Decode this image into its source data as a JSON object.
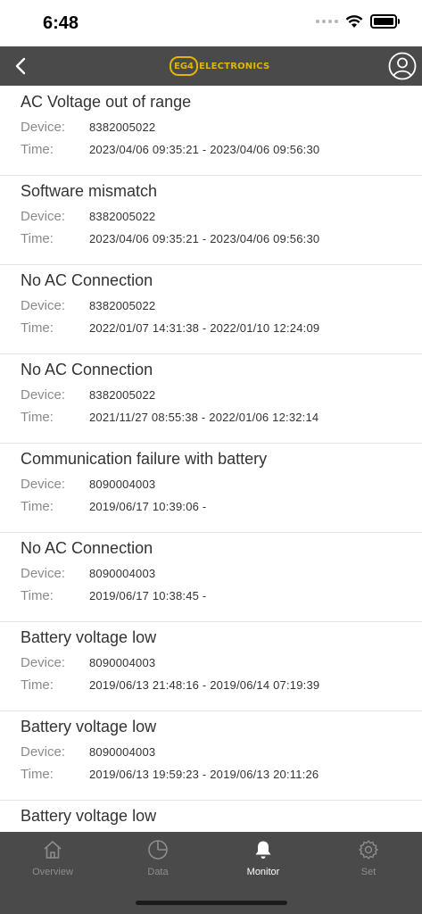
{
  "status_bar": {
    "time": "6:48"
  },
  "header": {
    "logo_badge": "EG4",
    "logo_text": "ELECTRONICS"
  },
  "labels": {
    "device": "Device:",
    "time": "Time:"
  },
  "alarms": [
    {
      "title": "AC Voltage out of range",
      "device": "8382005022",
      "time": "2023/04/06 09:35:21 - 2023/04/06 09:56:30"
    },
    {
      "title": "Software mismatch",
      "device": "8382005022",
      "time": "2023/04/06 09:35:21 - 2023/04/06 09:56:30"
    },
    {
      "title": "No AC Connection",
      "device": "8382005022",
      "time": "2022/01/07 14:31:38 - 2022/01/10 12:24:09"
    },
    {
      "title": "No AC Connection",
      "device": "8382005022",
      "time": "2021/11/27 08:55:38 - 2022/01/06 12:32:14"
    },
    {
      "title": "Communication failure with battery",
      "device": "8090004003",
      "time": "2019/06/17 10:39:06 -"
    },
    {
      "title": "No AC Connection",
      "device": "8090004003",
      "time": "2019/06/17 10:38:45 -"
    },
    {
      "title": "Battery voltage low",
      "device": "8090004003",
      "time": "2019/06/13 21:48:16 - 2019/06/14 07:19:39"
    },
    {
      "title": "Battery voltage low",
      "device": "8090004003",
      "time": "2019/06/13 19:59:23 - 2019/06/13 20:11:26"
    },
    {
      "title": "Battery voltage low"
    }
  ],
  "tabs": [
    {
      "label": "Overview",
      "icon": "home-icon",
      "active": false
    },
    {
      "label": "Data",
      "icon": "pie-chart-icon",
      "active": false
    },
    {
      "label": "Monitor",
      "icon": "bell-icon",
      "active": true
    },
    {
      "label": "Set",
      "icon": "gear-icon",
      "active": false
    }
  ],
  "colors": {
    "nav": "#4a4a4a",
    "accent": "#e2b600",
    "active_tab": "#ffffff",
    "inactive_tab": "#8d8d8d"
  }
}
